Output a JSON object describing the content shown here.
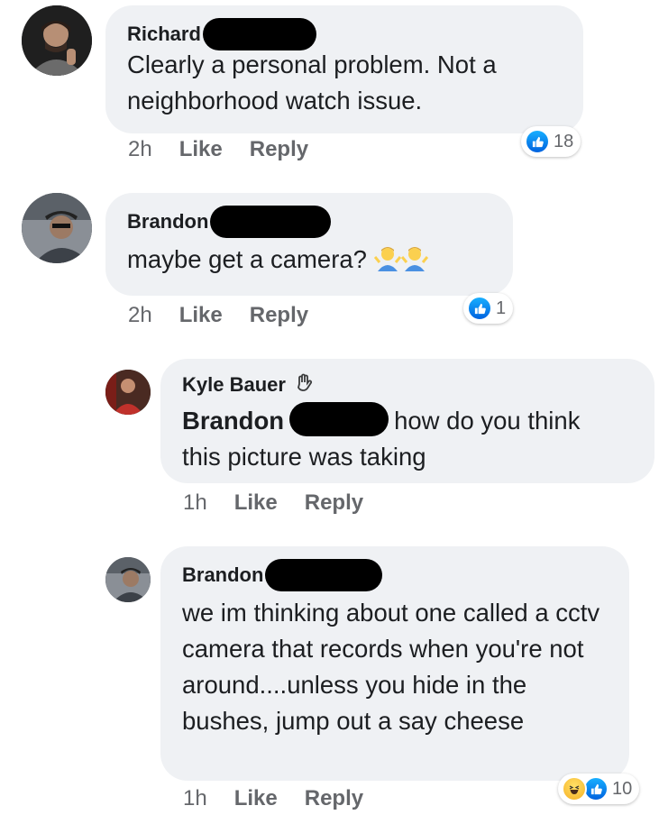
{
  "comments": [
    {
      "author": "Richard",
      "text": "Clearly a personal problem. Not a neighborhood watch issue.",
      "time": "2h",
      "like_label": "Like",
      "reply_label": "Reply",
      "reaction_count": "18"
    },
    {
      "author": "Brandon",
      "text": "maybe get a camera?",
      "emoji": "shrug-emoji",
      "time": "2h",
      "like_label": "Like",
      "reply_label": "Reply",
      "reaction_count": "1"
    },
    {
      "author": "Kyle Bauer",
      "mention": "Brandon",
      "text_after_redaction": "how do you think",
      "text_line2": "this picture was taking",
      "time": "1h",
      "like_label": "Like",
      "reply_label": "Reply"
    },
    {
      "author": "Brandon",
      "text": "we im thinking about one called a cctv camera that records when you're not around....unless you hide in the bushes, jump out a say cheese",
      "time": "1h",
      "like_label": "Like",
      "reply_label": "Reply",
      "reaction_count": "10"
    }
  ],
  "colors": {
    "bubble": "#eff1f4",
    "meta_text": "#65676b",
    "like_blue": "#1877f2"
  }
}
